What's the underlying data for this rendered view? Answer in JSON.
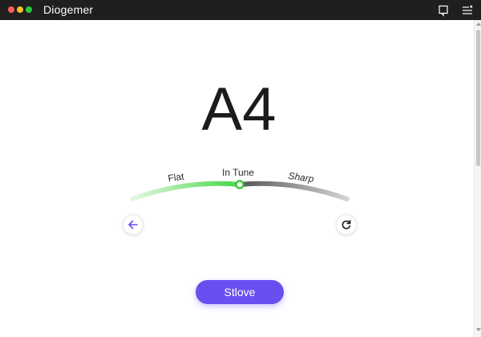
{
  "window": {
    "title": "Diogemer"
  },
  "tuner": {
    "note": "A4",
    "labels": {
      "flat": "Flat",
      "in_tune": "In Tune",
      "sharp": "Sharp"
    },
    "deviation": 0
  },
  "actions": {
    "primary_label": "Stlove"
  },
  "icons": {
    "feedback": "message-square-icon",
    "menu": "menu-list-icon",
    "back": "arrow-left-icon",
    "reset": "rotate-cw-icon"
  },
  "colors": {
    "accent": "#6a4ff0",
    "in_tune_green": "#4fd94f",
    "titlebar": "#1f1f1f"
  }
}
